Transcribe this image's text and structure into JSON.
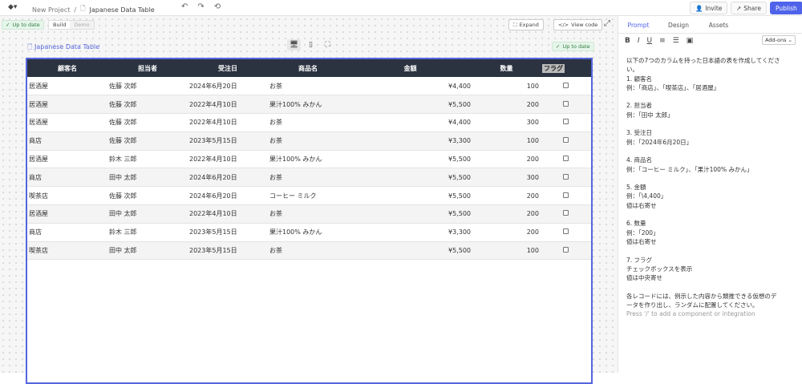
{
  "topbar": {
    "project": "New Project",
    "sep": "/",
    "page": "Japanese Data Table",
    "invite": "Invite",
    "share": "Share",
    "publish": "Publish"
  },
  "toolbar": {
    "status": "Up to date",
    "build": "Build",
    "demo": "Demo",
    "expand": "Expand",
    "view_code": "View code"
  },
  "preview": {
    "title": "Japanese Data Table",
    "status": "Up to date"
  },
  "table": {
    "headers": [
      "顧客名",
      "担当者",
      "受注日",
      "商品名",
      "金額",
      "数量",
      "フラグ"
    ],
    "rows": [
      [
        "居酒屋",
        "佐藤 次郎",
        "2024年6月20日",
        "お茶",
        "¥4,400",
        "100"
      ],
      [
        "居酒屋",
        "佐藤 次郎",
        "2022年4月10日",
        "果汁100% みかん",
        "¥5,500",
        "200"
      ],
      [
        "居酒屋",
        "佐藤 次郎",
        "2022年4月10日",
        "お茶",
        "¥4,400",
        "300"
      ],
      [
        "商店",
        "佐藤 次郎",
        "2023年5月15日",
        "お茶",
        "¥3,300",
        "100"
      ],
      [
        "居酒屋",
        "鈴木 三郎",
        "2022年4月10日",
        "果汁100% みかん",
        "¥5,500",
        "200"
      ],
      [
        "商店",
        "田中 太郎",
        "2024年6月20日",
        "お茶",
        "¥5,500",
        "300"
      ],
      [
        "喫茶店",
        "佐藤 次郎",
        "2024年6月20日",
        "コーヒー ミルク",
        "¥5,500",
        "200"
      ],
      [
        "居酒屋",
        "田中 太郎",
        "2022年4月10日",
        "お茶",
        "¥5,500",
        "200"
      ],
      [
        "商店",
        "鈴木 三郎",
        "2023年5月15日",
        "果汁100% みかん",
        "¥3,300",
        "200"
      ],
      [
        "喫茶店",
        "田中 太郎",
        "2023年5月15日",
        "お茶",
        "¥5,500",
        "100"
      ]
    ]
  },
  "panel": {
    "tabs": [
      "Prompt",
      "Design",
      "Assets"
    ],
    "addons": "Add-ons",
    "prompt_lines": [
      "以下の7つのカラムを持った日本語の表を作成してくださ",
      "い。",
      "1. 顧客名",
      "例：「商店」、「喫茶店」、「居酒屋」",
      "",
      "2. 担当者",
      "例：「田中 太郎」",
      "",
      "3. 受注日",
      "例：「2024年6月20日」",
      "",
      "4. 商品名",
      "例：「コーヒー ミルク」、「果汁100% みかん」",
      "",
      "5. 金額",
      "例：「\\4,400」",
      "値は右寄せ",
      "",
      "6. 数量",
      "例：「200」",
      "値は右寄せ",
      "",
      "7. フラグ",
      "チェックボックスを表示",
      "値は中央寄せ",
      "",
      "各レコードには、例示した内容から類推できる仮想のデ",
      "ータを作り出し、ランダムに配置してください。"
    ],
    "hint": "Press '/' to add a component or integration"
  }
}
